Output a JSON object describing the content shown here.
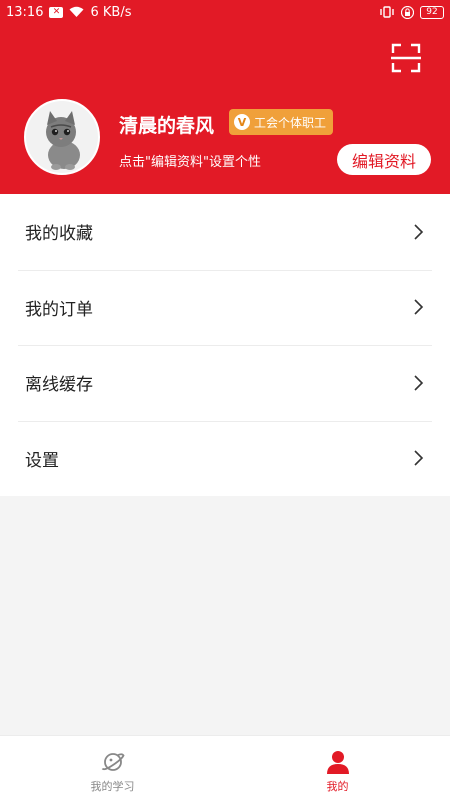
{
  "status_bar": {
    "time": "13:16",
    "notification_badge": "✕",
    "network_speed": "6 KB/s",
    "battery": "92"
  },
  "profile": {
    "username": "清晨的春风",
    "badge_icon": "V",
    "badge_text": "工会个体职工",
    "hint": "点击\"编辑资料\"设置个性",
    "edit_button": "编辑资料",
    "avatar_icon": "cat-avatar-icon"
  },
  "menu": {
    "items": [
      {
        "label": "我的收藏"
      },
      {
        "label": "我的订单"
      },
      {
        "label": "离线缓存"
      },
      {
        "label": "设置"
      }
    ]
  },
  "tabs": [
    {
      "label": "我的学习",
      "icon": "planet-icon",
      "active": false
    },
    {
      "label": "我的",
      "icon": "person-icon",
      "active": true
    }
  ],
  "colors": {
    "brand_red": "#e21a26",
    "badge_orange": "#f0a03a",
    "background": "#f4f4f4"
  }
}
